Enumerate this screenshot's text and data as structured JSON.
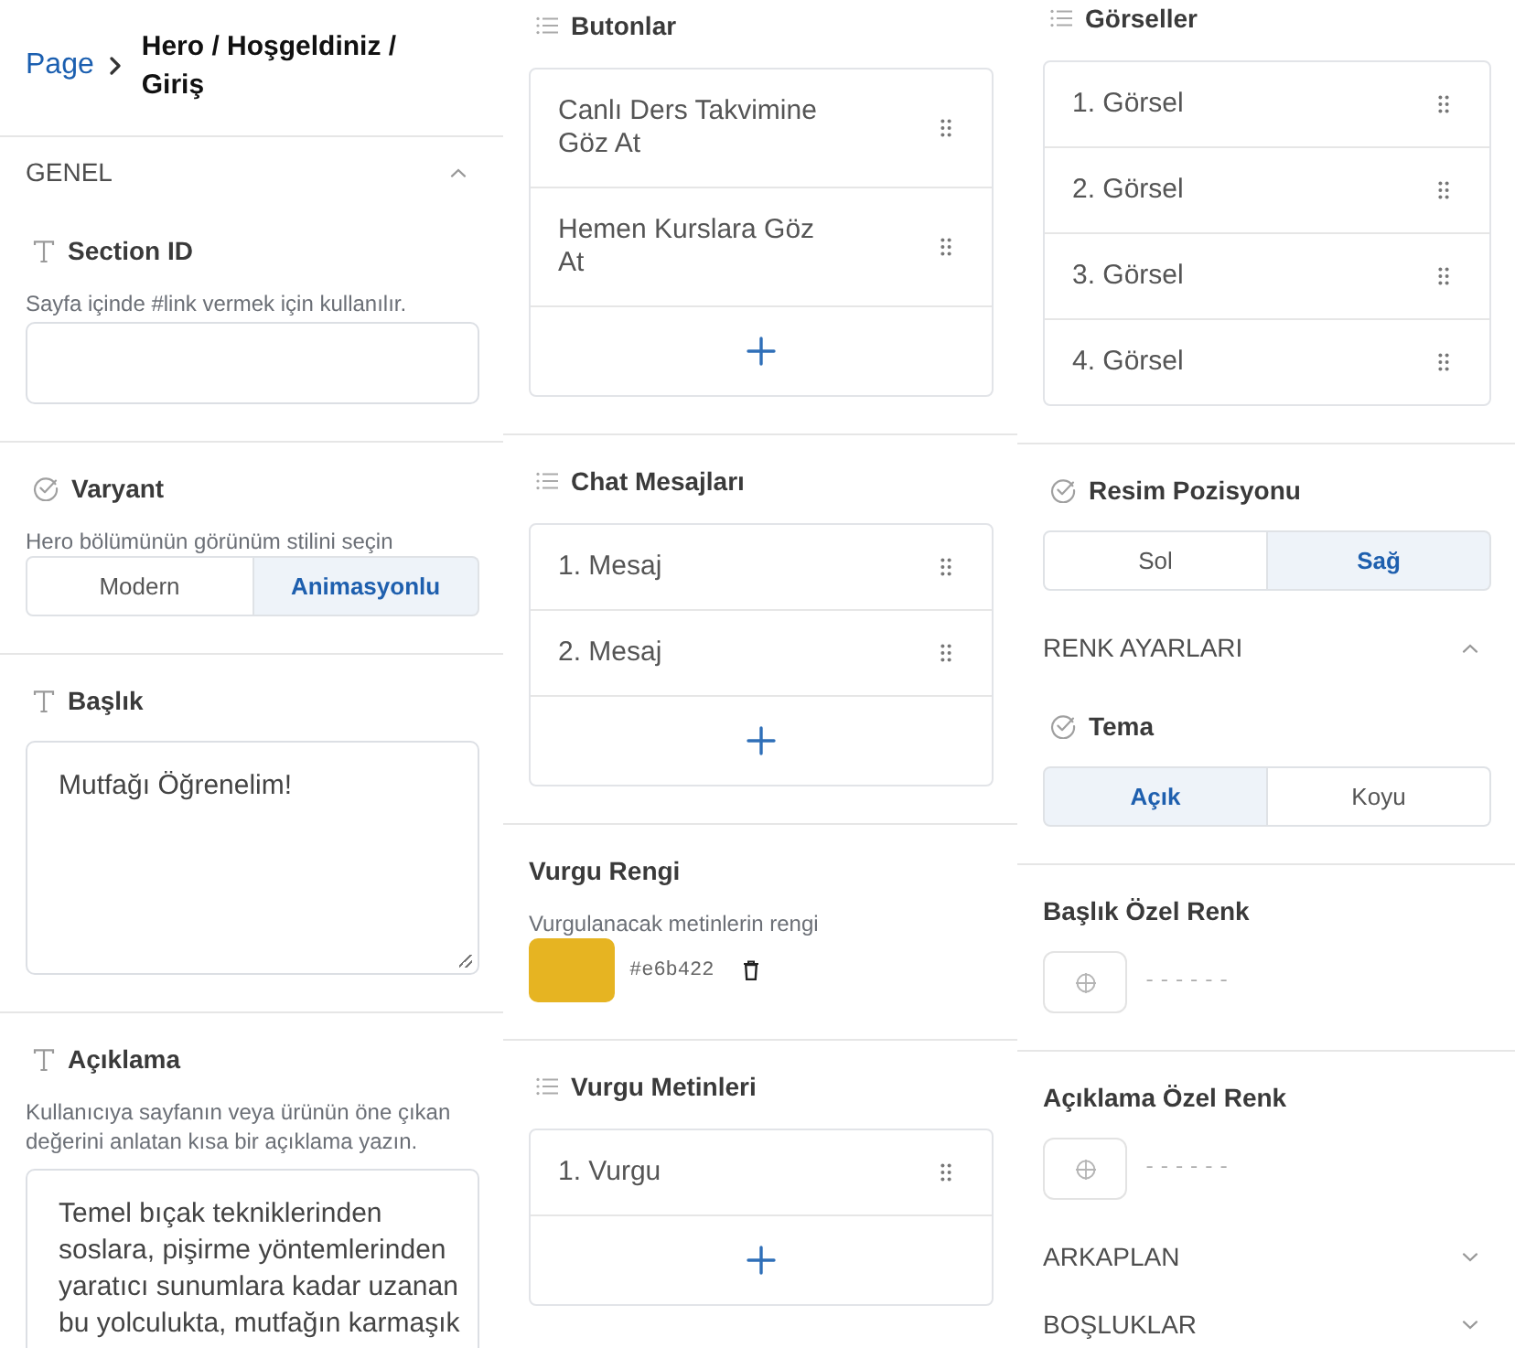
{
  "panels": [
    {
      "sections": [
        {
          "kind": "breadcrumb",
          "link": "Page",
          "title": "Hero / Hoşgeldiniz / Giriş"
        },
        {
          "kind": "group",
          "label": "GENEL",
          "expanded": true
        },
        {
          "kind": "text",
          "label": "Section ID",
          "description": "Sayfa içinde #link vermek için kullanılır."
        },
        {
          "kind": "choice",
          "label": "Varyant",
          "description": "Hero bölümünün görünüm stilini seçin",
          "options": [
            {
              "label": "Modern",
              "selected": false
            },
            {
              "label": "Animasyonlu",
              "selected": true
            }
          ]
        },
        {
          "kind": "textarea",
          "label": "Başlık",
          "value": "Mutfağı Öğrenelim!"
        },
        {
          "kind": "textarea",
          "label": "Açıklama",
          "description": "Kullanıcıya sayfanın veya ürünün öne çıkan değerini anlatan kısa bir açıklama yazın.",
          "value": "Temel bıçak tekniklerinden soslara, pişirme yöntemlerinden yaratıcı sunumlara kadar uzanan bu yolculukta, mutfağın karmaşık"
        }
      ]
    },
    {
      "sections": [
        {
          "kind": "list",
          "label": "Butonlar",
          "can_add": true,
          "items": [
            "Canlı Ders Takvimine Göz At",
            "Hemen Kurslara Göz At"
          ]
        },
        {
          "kind": "list",
          "label": "Chat Mesajları",
          "can_add": true,
          "items": [
            "1. Mesaj",
            "2. Mesaj"
          ]
        },
        {
          "kind": "color",
          "label": "Vurgu Rengi",
          "description": "Vurgulanacak metinlerin rengi",
          "value": "#e6b422",
          "color": "#e6b422"
        },
        {
          "kind": "list",
          "label": "Vurgu Metinleri",
          "can_add": true,
          "items": [
            "1. Vurgu"
          ]
        }
      ]
    },
    {
      "sections": [
        {
          "kind": "list",
          "label": "Görseller",
          "can_add": false,
          "items": [
            "1. Görsel",
            "2. Görsel",
            "3. Görsel",
            "4. Görsel"
          ]
        },
        {
          "kind": "choice",
          "label": "Resim Pozisyonu",
          "options": [
            {
              "label": "Sol",
              "selected": false
            },
            {
              "label": "Sağ",
              "selected": true
            }
          ]
        },
        {
          "kind": "group",
          "label": "RENK AYARLARI",
          "expanded": true
        },
        {
          "kind": "choice",
          "label": "Tema",
          "options": [
            {
              "label": "Açık",
              "selected": true
            },
            {
              "label": "Koyu",
              "selected": false
            }
          ]
        },
        {
          "kind": "color",
          "label": "Başlık Özel Renk",
          "value": "------"
        },
        {
          "kind": "color",
          "label": "Açıklama Özel Renk",
          "value": "------"
        },
        {
          "kind": "group",
          "label": "ARKAPLAN",
          "expanded": false
        },
        {
          "kind": "group",
          "label": "BOŞLUKLAR",
          "expanded": false
        }
      ]
    }
  ]
}
